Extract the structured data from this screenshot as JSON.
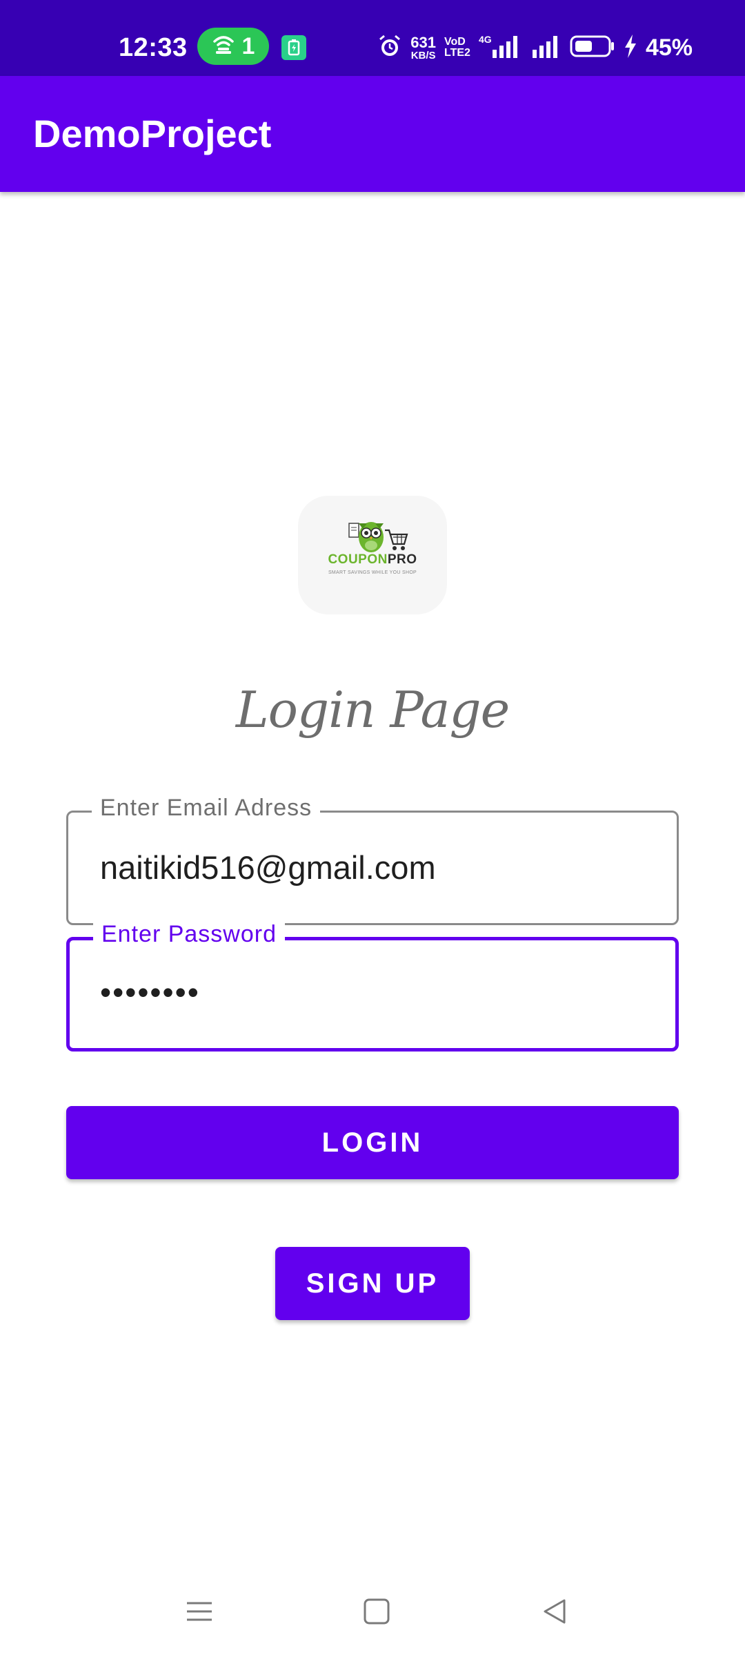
{
  "status_bar": {
    "time": "12:33",
    "hotspot_count": "1",
    "net_speed_value": "631",
    "net_speed_unit": "KB/S",
    "volte_line1": "VoD",
    "volte_line2": "LTE2",
    "network_type": "4G",
    "battery_percent": "45%",
    "icons": [
      "hotspot-icon",
      "battery-saver-icon",
      "alarm-icon",
      "signal-icon",
      "battery-icon",
      "charging-icon"
    ]
  },
  "app_bar": {
    "title": "DemoProject",
    "color": "#6200ee"
  },
  "logo": {
    "brand_first": "COUPON",
    "brand_second": "PRO",
    "tagline": "SMART SAVINGS WHILE YOU SHOP"
  },
  "heading": "Login Page",
  "form": {
    "email": {
      "label": "Enter Email Adress",
      "value": "naitikid516@gmail.com"
    },
    "password": {
      "label": "Enter Password",
      "value": "••••••••"
    }
  },
  "buttons": {
    "login": "LOGIN",
    "signup": "SIGN UP"
  },
  "colors": {
    "primary": "#6200ee",
    "primary_dark": "#3700b3",
    "hotspot_green": "#2bc656"
  },
  "nav": {
    "icons": [
      "menu-icon",
      "home-icon",
      "back-icon"
    ]
  }
}
